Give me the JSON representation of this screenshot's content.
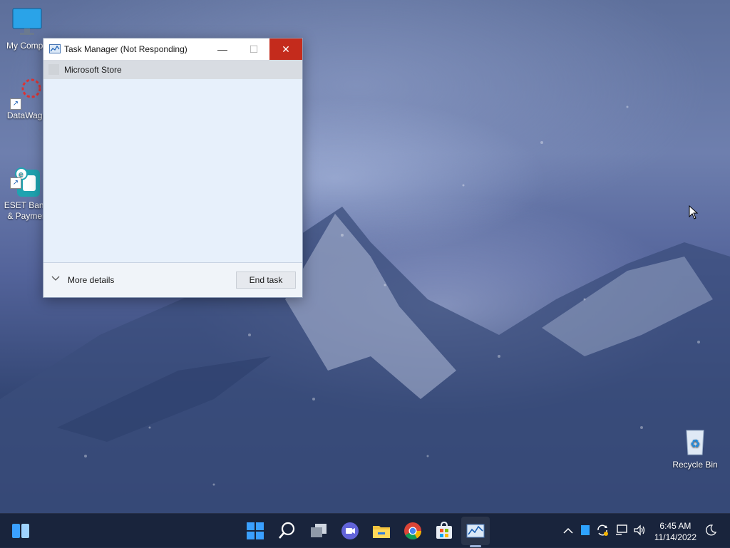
{
  "desktop": {
    "icons": [
      {
        "label": "My Compu"
      },
      {
        "label": "DataWago"
      },
      {
        "label": "ESET Banki\n& Paymen"
      },
      {
        "label": "Recycle Bin"
      }
    ]
  },
  "window": {
    "title": "Task Manager (Not Responding)",
    "minimize_glyph": "—",
    "maximize_glyph": "☐",
    "close_glyph": "✕",
    "processes": [
      {
        "name": "Microsoft Store"
      }
    ],
    "footer": {
      "more_details_label": "More details",
      "end_task_label": "End task"
    }
  },
  "taskbar": {
    "icons": [
      "widgets-icon",
      "start-icon",
      "search-icon",
      "task-view-icon",
      "chat-icon",
      "file-explorer-icon",
      "chrome-icon",
      "microsoft-store-icon",
      "task-manager-icon"
    ],
    "tray": {
      "clock_time": "6:45 AM",
      "clock_date": "11/14/2022"
    }
  },
  "colors": {
    "close_button": "#c42b1c",
    "window_body": "#e7f0fb",
    "taskbar": "#172137"
  }
}
